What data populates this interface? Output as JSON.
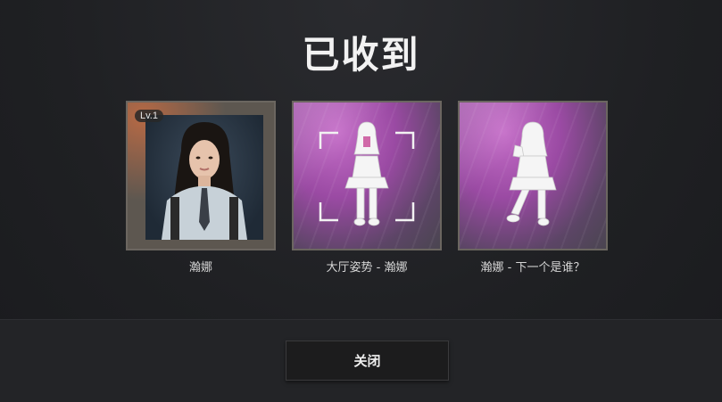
{
  "dialog": {
    "title": "已收到",
    "close_label": "关闭"
  },
  "rewards": [
    {
      "label": "瀚娜",
      "badge": "Lv.1",
      "icon": "character-portrait"
    },
    {
      "label": "大厅姿势 - 瀚娜",
      "icon": "lobby-pose-figure"
    },
    {
      "label": "瀚娜 - 下一个是谁？",
      "icon": "emote-figure"
    }
  ],
  "colors": {
    "accent_purple": "#9a4aa3",
    "frame": "#6b6660",
    "background": "#1d1e21"
  }
}
